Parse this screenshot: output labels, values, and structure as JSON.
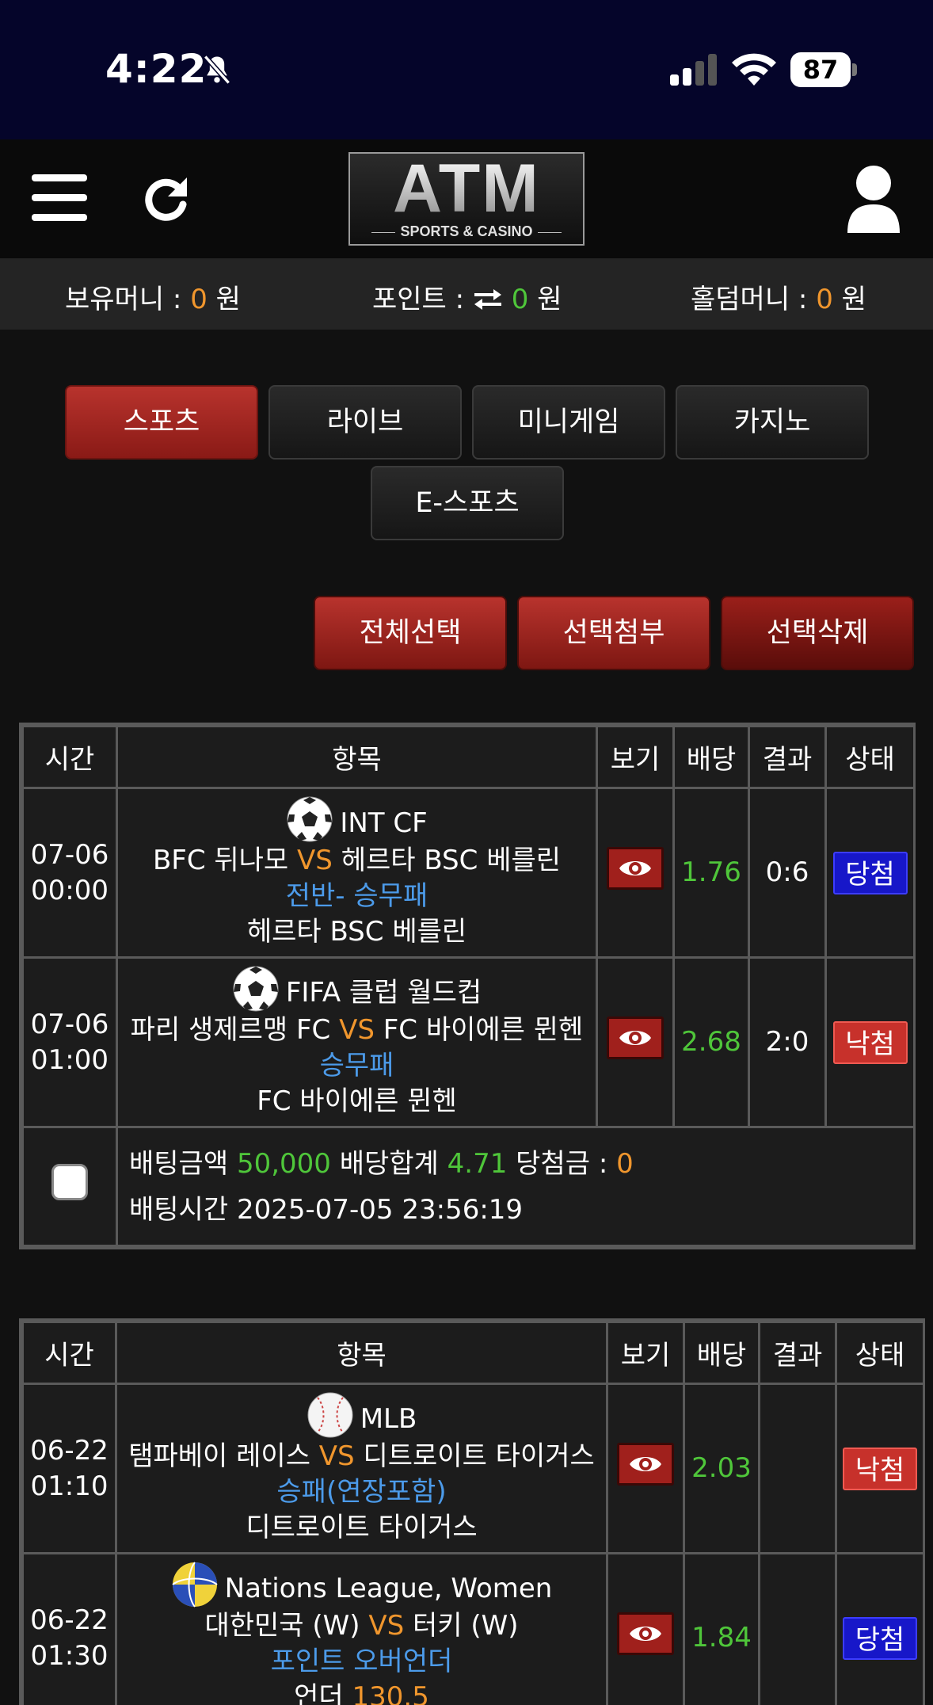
{
  "status_bar": {
    "time": "4:22",
    "battery": "87",
    "icons": [
      "bell-slash-icon",
      "cellular-signal-icon",
      "wifi-icon",
      "battery-icon"
    ]
  },
  "header": {
    "logo_main": "ATM",
    "logo_sub": "SPORTS & CASINO",
    "icons": [
      "hamburger-menu-icon",
      "refresh-icon",
      "user-icon"
    ]
  },
  "balance": {
    "money_label": "보유머니 :",
    "money_value": "0",
    "point_label": "포인트 :",
    "point_value": "0",
    "holdem_label": "홀덤머니 :",
    "holdem_value": "0",
    "unit": "원"
  },
  "tabs": [
    "스포츠",
    "라이브",
    "미니게임",
    "카지노",
    "E-스포츠"
  ],
  "actions": {
    "select_all": "전체선택",
    "attach_selected": "선택첨부",
    "delete_selected": "선택삭제"
  },
  "columns": [
    "시간",
    "항목",
    "보기",
    "배당",
    "결과",
    "상태"
  ],
  "bets": [
    {
      "rows": [
        {
          "date": "07-06",
          "time": "00:00",
          "league": "INT CF",
          "sport_icon": "soccer-ball-icon",
          "home": "BFC 뒤나모",
          "vs": "VS",
          "away": "헤르타 BSC 베를린",
          "market": "전반- 승무패",
          "pick": "헤르타 BSC 베를린",
          "pick_value": "",
          "odds": "1.76",
          "result": "0:6",
          "status": "당첨",
          "status_type": "win"
        },
        {
          "date": "07-06",
          "time": "01:00",
          "league": "FIFA 클럽 월드컵",
          "sport_icon": "soccer-ball-icon",
          "home": "파리 생제르맹 FC",
          "vs": "VS",
          "away": "FC 바이에른 뮌헨",
          "market": "승무패",
          "pick": "FC 바이에른 뮌헨",
          "pick_value": "",
          "odds": "2.68",
          "result": "2:0",
          "status": "낙첨",
          "status_type": "lose"
        }
      ],
      "summary": {
        "amount_label": "배팅금액",
        "amount": "50,000",
        "total_odds_label": "배당합계",
        "total_odds": "4.71",
        "win_label": "당첨금 :",
        "win_amount": "0",
        "time_label": "배팅시간",
        "time": "2025-07-05 23:56:19"
      }
    },
    {
      "rows": [
        {
          "date": "06-22",
          "time": "01:10",
          "league": "MLB",
          "sport_icon": "baseball-icon",
          "home": "탬파베이 레이스",
          "vs": "VS",
          "away": "디트로이트 타이거스",
          "market": "승패(연장포함)",
          "pick": "디트로이트 타이거스",
          "pick_value": "",
          "odds": "2.03",
          "result": "",
          "status": "낙첨",
          "status_type": "lose"
        },
        {
          "date": "06-22",
          "time": "01:30",
          "league": "Nations League, Women",
          "sport_icon": "volleyball-icon",
          "home": "대한민국 (W)",
          "vs": "VS",
          "away": "터키 (W)",
          "market": "포인트 오버언더",
          "pick": "언더",
          "pick_value": "130.5",
          "odds": "1.84",
          "result": "",
          "status": "당첨",
          "status_type": "win"
        }
      ]
    }
  ]
}
